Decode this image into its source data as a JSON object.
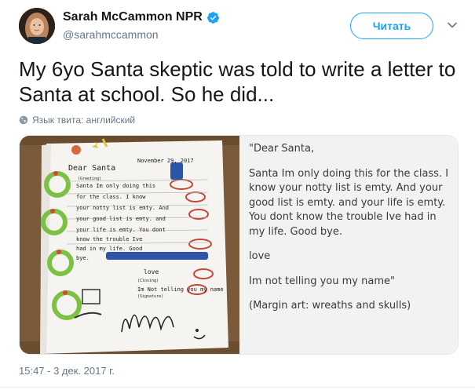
{
  "author": {
    "display_name": "Sarah McCammon NPR",
    "handle": "@sarahmccammon",
    "verified": true
  },
  "follow_button": {
    "label": "Читать"
  },
  "menu_icon": "chevron-down-icon",
  "tweet": {
    "text": "My 6yo Santa skeptic was told to write a letter to Santa at school. So he did...",
    "language_note": "Язык твита: английский"
  },
  "media": {
    "letter_photo": {
      "greeting": "Dear Santa",
      "date": "November 29, 2017",
      "field_greeting": "(Greeting)",
      "field_closing": "(Closing)",
      "field_signature": "(Signature)",
      "closing": "love",
      "body_lines": [
        "Santa Im only doing this",
        "for the class. I know",
        "your notty list is emty. And",
        "your good list is emty. and",
        "your life is emty. You dont",
        "know the trouble Ive",
        "had in my life. Good",
        "bye."
      ],
      "signature": "Im Not telling you my name"
    },
    "transcript": {
      "paragraphs": [
        "\"Dear Santa,",
        "Santa Im only doing this for the class. I know your notty list is emty. And your good list is emty. and your life is emty. You dont know the trouble Ive had in my life. Good bye.",
        "love",
        "Im not telling you my name\"",
        "(Margin art: wreaths and skulls)"
      ]
    }
  },
  "timestamp": "15:47 - 3 дек. 2017 г.",
  "colors": {
    "accent": "#1da1f2",
    "text": "#14171a",
    "secondary_text": "#657786",
    "transcript_bg": "#f2f2f2"
  }
}
